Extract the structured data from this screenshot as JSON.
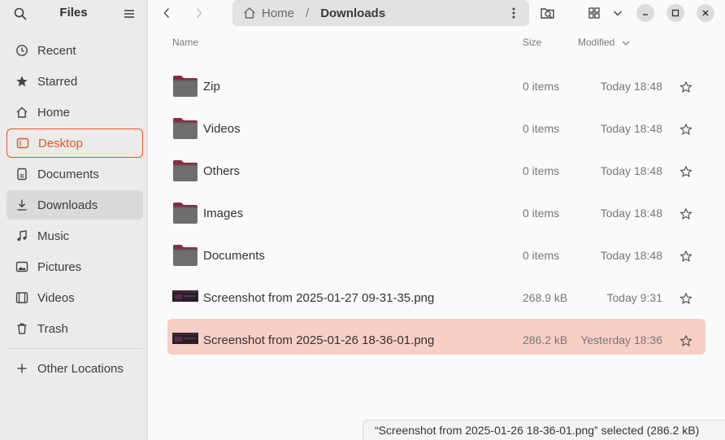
{
  "app": {
    "title": "Files"
  },
  "sidebar": {
    "items": [
      {
        "label": "Recent",
        "icon": "clock-icon"
      },
      {
        "label": "Starred",
        "icon": "star-icon"
      },
      {
        "label": "Home",
        "icon": "home-icon"
      },
      {
        "label": "Desktop",
        "icon": "desktop-icon",
        "state": "focused"
      },
      {
        "label": "Documents",
        "icon": "document-icon"
      },
      {
        "label": "Downloads",
        "icon": "download-icon",
        "state": "active"
      },
      {
        "label": "Music",
        "icon": "music-icon"
      },
      {
        "label": "Pictures",
        "icon": "picture-icon"
      },
      {
        "label": "Videos",
        "icon": "video-icon"
      },
      {
        "label": "Trash",
        "icon": "trash-icon"
      }
    ],
    "other_locations": {
      "label": "Other Locations",
      "icon": "plus-icon"
    }
  },
  "pathbar": {
    "home": "Home",
    "separator": "/",
    "current": "Downloads"
  },
  "columns": {
    "name": "Name",
    "size": "Size",
    "modified": "Modified"
  },
  "files": [
    {
      "name": "Zip",
      "type": "folder",
      "size": "0 items",
      "modified": "Today 18:48",
      "selected": false
    },
    {
      "name": "Videos",
      "type": "folder",
      "size": "0 items",
      "modified": "Today 18:48",
      "selected": false
    },
    {
      "name": "Others",
      "type": "folder",
      "size": "0 items",
      "modified": "Today 18:48",
      "selected": false
    },
    {
      "name": "Images",
      "type": "folder",
      "size": "0 items",
      "modified": "Today 18:48",
      "selected": false
    },
    {
      "name": "Documents",
      "type": "folder",
      "size": "0 items",
      "modified": "Today 18:48",
      "selected": false
    },
    {
      "name": "Screenshot from 2025-01-27 09-31-35.png",
      "type": "image",
      "size": "268.9 kB",
      "modified": "Today 9:31",
      "selected": false
    },
    {
      "name": "Screenshot from 2025-01-26 18-36-01.png",
      "type": "image",
      "size": "286.2 kB",
      "modified": "Yesterday 18:36",
      "selected": true
    }
  ],
  "status": {
    "text": "“Screenshot from 2025-01-26 18-36-01.png” selected  (286.2 kB)"
  },
  "colors": {
    "accent": "#e95420",
    "selection": "#f8cfc4",
    "folder_tab": "#8b2a3e",
    "folder_body": "#6e6e6e"
  }
}
